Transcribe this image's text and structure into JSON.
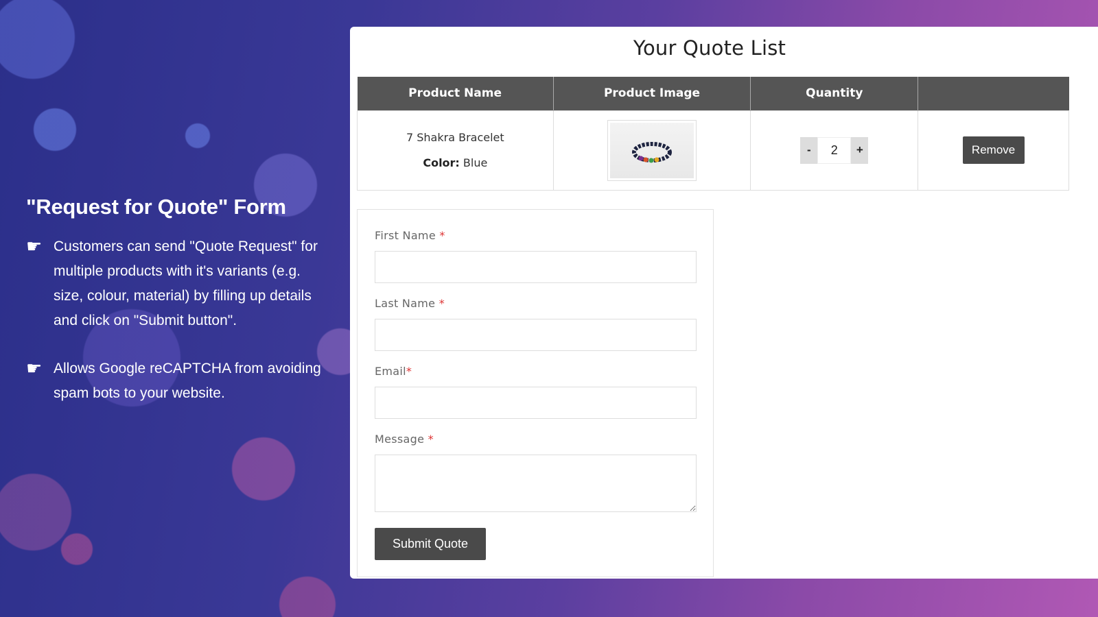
{
  "promo": {
    "title": "\"Request for Quote\" Form",
    "bullets": [
      "Customers can send \"Quote Request\" for multiple products with it's variants (e.g. size, colour, material) by filling up details and click on \"Submit button\".",
      "Allows Google reCAPTCHA from avoiding spam bots to your website."
    ],
    "bullet_icon": "pointing-hand-icon"
  },
  "quote": {
    "title": "Your Quote List",
    "columns": [
      "Product Name",
      "Product Image",
      "Quantity",
      ""
    ],
    "items": [
      {
        "name": "7 Shakra Bracelet",
        "option_label": "Color:",
        "option_value": "Blue",
        "quantity": "2",
        "minus_label": "-",
        "plus_label": "+",
        "remove_label": "Remove"
      }
    ]
  },
  "form": {
    "first_name_label": "First Name",
    "last_name_label": "Last Name",
    "email_label": "Email",
    "message_label": "Message",
    "required_mark": "*",
    "submit_label": "Submit Quote"
  },
  "colors": {
    "header_bg": "#555555",
    "button_bg": "#4a4a4a",
    "required": "#dd3333"
  }
}
